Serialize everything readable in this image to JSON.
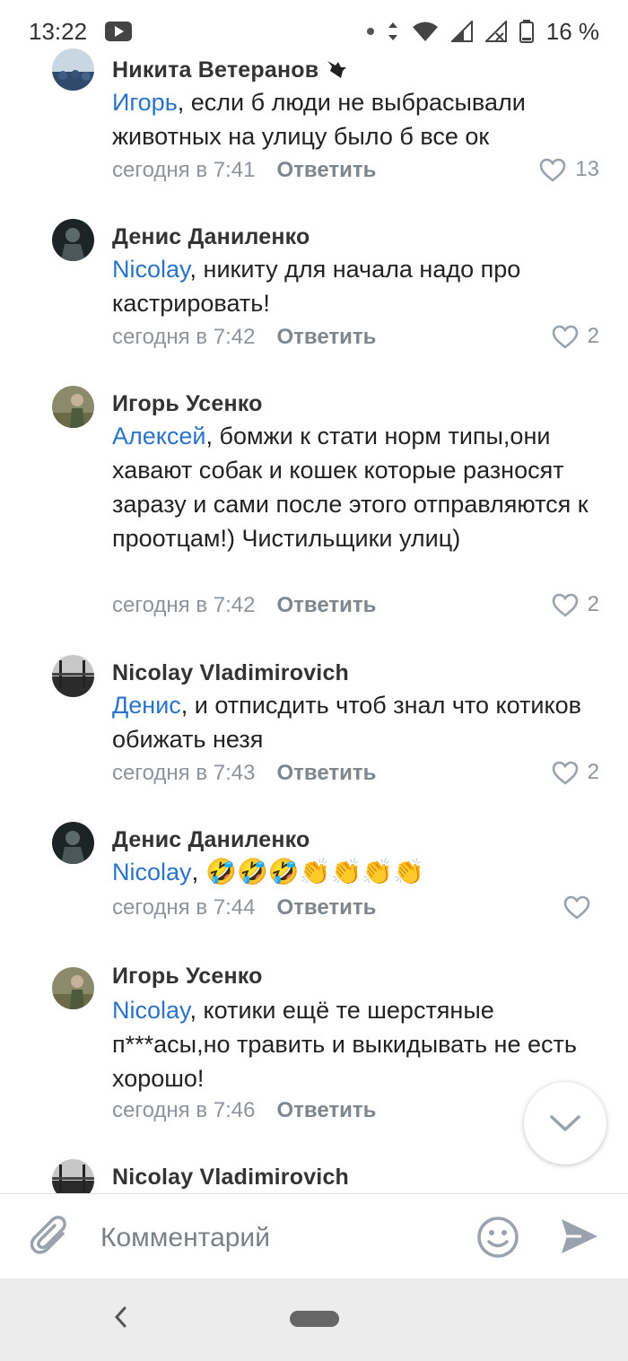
{
  "status_bar": {
    "time": "13:22",
    "battery": "16 %",
    "icons": [
      "youtube-icon",
      "dot-icon",
      "data-arrows-icon",
      "wifi-icon",
      "signal-icon",
      "signal-off-icon",
      "battery-icon"
    ]
  },
  "comments": [
    {
      "author": "Никита Ветеранов",
      "mention": "Игорь",
      "text": ", если б люди не выбрасывали животных на улицу было б все ок",
      "time": "сегодня в 7:41",
      "reply": "Ответить",
      "likes": "13"
    },
    {
      "author": "Денис Даниленко",
      "mention": "Nicolay",
      "text": ", никиту для начала надо про кастрировать!",
      "time": "сегодня в 7:42",
      "reply": "Ответить",
      "likes": "2"
    },
    {
      "author": "Игорь Усенко",
      "mention": "Алексей",
      "text": ", бомжи к стати норм типы,они хавают собак и кошек которые разносят заразу и сами после этого отправляются к проотцам!) Чистильщики улиц)",
      "time": "сегодня в 7:42",
      "reply": "Ответить",
      "likes": "2"
    },
    {
      "author": "Nicolay Vladimirovich",
      "mention": "Денис",
      "text": ", и отписдить чтоб знал что котиков обижать незя",
      "time": "сегодня в 7:43",
      "reply": "Ответить",
      "likes": "2"
    },
    {
      "author": "Денис Даниленко",
      "mention": "Nicolay",
      "text": ", 🤣🤣🤣👏👏👏👏",
      "time": "сегодня в 7:44",
      "reply": "Ответить",
      "likes": ""
    },
    {
      "author": "Игорь Усенко",
      "mention": "Nicolay",
      "text": ", котики ещё те шерстяные п***асы,но травить и выкидывать не есть хорошо!",
      "time": "сегодня в 7:46",
      "reply": "Ответить",
      "likes": ""
    },
    {
      "author": "Nicolay Vladimirovich",
      "mention": "",
      "text": "",
      "time": "",
      "reply": "",
      "likes": ""
    }
  ],
  "composer": {
    "placeholder": "Комментарий",
    "icons": [
      "paperclip-icon",
      "smile-icon",
      "send-icon"
    ]
  },
  "colors": {
    "mention": "#2a73c9",
    "meta": "#8e949a",
    "accent": "#99a2ad"
  }
}
